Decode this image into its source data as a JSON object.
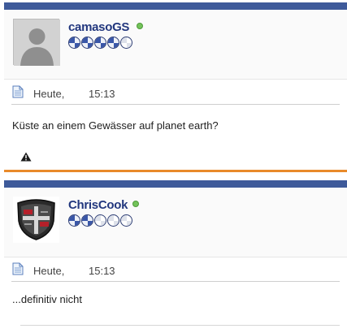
{
  "posts": [
    {
      "username": "camasoGS",
      "avatar": "default-user-silhouette",
      "online": true,
      "rank_stars_filled": 4,
      "rank_stars_total": 5,
      "date": "Heute,",
      "time": "15:13",
      "message": "Küste an einem Gewässer auf planet earth?",
      "icons": [
        "document-icon",
        "warning-icon"
      ]
    },
    {
      "username": "ChrisCook",
      "avatar": "shield-crest",
      "online": true,
      "rank_stars_filled": 2,
      "rank_stars_total": 5,
      "date": "Heute,",
      "time": "15:13",
      "message": "...definitiv nicht",
      "icons": [
        "document-icon"
      ]
    }
  ],
  "colors": {
    "header_bar": "#3e5a9a",
    "separator": "#e98a2a",
    "username": "#22377e",
    "online": "#73c35a"
  }
}
